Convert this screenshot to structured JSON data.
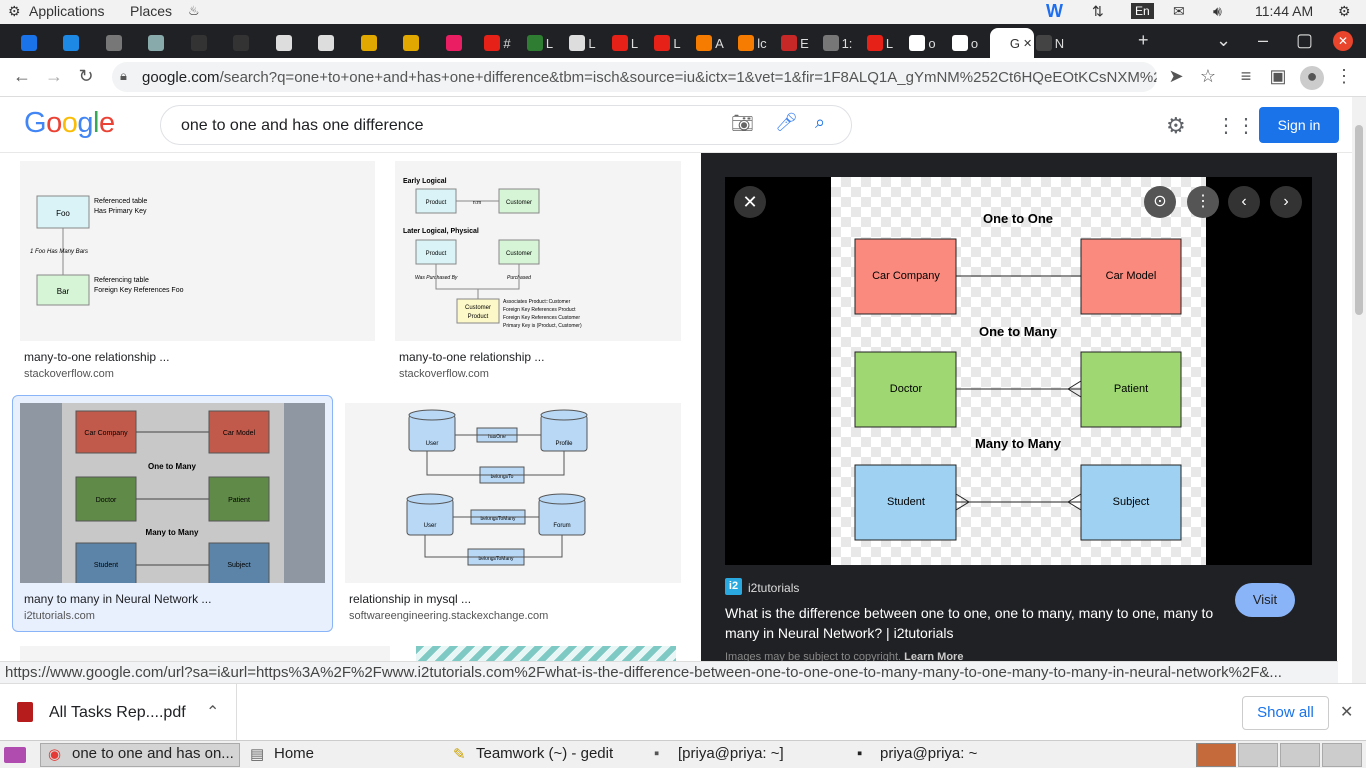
{
  "system": {
    "applications": "Applications",
    "places": "Places",
    "lang": "En",
    "time": "11:44 AM"
  },
  "tabs": [
    {
      "label": "",
      "color": "#1a73e8",
      "icon": "k-icon"
    },
    {
      "label": "",
      "color": "#1e88e5",
      "icon": "s-icon"
    },
    {
      "label": "",
      "color": "#777",
      "icon": "globe-icon"
    },
    {
      "label": "",
      "color": "#8aa",
      "icon": "shield-icon"
    },
    {
      "label": "",
      "color": "#333",
      "icon": "owl-icon"
    },
    {
      "label": "",
      "color": "#333",
      "icon": "github-icon"
    },
    {
      "label": "",
      "color": "#ddd",
      "icon": "dev-icon"
    },
    {
      "label": "",
      "color": "#ddd",
      "icon": "dev-icon"
    },
    {
      "label": "",
      "color": "#e0a800",
      "icon": "d-icon"
    },
    {
      "label": "",
      "color": "#e0a800",
      "icon": "d-icon"
    },
    {
      "label": "",
      "color": "#e91e63",
      "icon": "robot-icon"
    },
    {
      "label": "#",
      "color": "#e62117",
      "icon": "youtube-icon"
    },
    {
      "label": "L",
      "color": "#2e7d32",
      "icon": "ns-icon"
    },
    {
      "label": "L",
      "color": "#ddd",
      "icon": "dev-icon"
    },
    {
      "label": "L",
      "color": "#e62117",
      "icon": "youtube-icon"
    },
    {
      "label": "L",
      "color": "#e62117",
      "icon": "youtube-icon"
    },
    {
      "label": "A",
      "color": "#f57c00",
      "icon": "xampp-icon"
    },
    {
      "label": "lc",
      "color": "#f57c00",
      "icon": "cone-icon"
    },
    {
      "label": "E",
      "color": "#c62828",
      "icon": "laravel-icon"
    },
    {
      "label": "1:",
      "color": "#777",
      "icon": "circle-icon"
    },
    {
      "label": "L",
      "color": "#e62117",
      "icon": "youtube-icon"
    },
    {
      "label": "o",
      "color": "#fff",
      "icon": "google-icon"
    },
    {
      "label": "o",
      "color": "#fff",
      "icon": "google-icon"
    },
    {
      "label": "G",
      "color": "#fff",
      "icon": "google-icon"
    },
    {
      "label": "N",
      "color": "#444",
      "icon": "circle-icon"
    }
  ],
  "address": {
    "url_domain": "google.com",
    "url_rest": "/search?q=one+to+one+and+has+one+difference&tbm=isch&source=iu&ictx=1&vet=1&fir=1F8ALQ1A_gYmNM%252Ct6HQeEOtKCsNXM%252C_..."
  },
  "google": {
    "logo": "Google",
    "query": "one to one and has one difference",
    "signin": "Sign in"
  },
  "results": [
    {
      "title": "many-to-one relationship ...",
      "source": "stackoverflow.com"
    },
    {
      "title": "many-to-one relationship ...",
      "source": "stackoverflow.com"
    },
    {
      "title": "many to many in Neural Network ...",
      "source": "i2tutorials.com"
    },
    {
      "title": "relationship in mysql ...",
      "source": "softwareengineering.stackexchange.com"
    }
  ],
  "thumb1": {
    "foo": "Foo",
    "bar": "Bar",
    "ref1": "Referenced table",
    "ref2": "Has Primary Key",
    "mid": "1 Foo Has Many Bars",
    "fk1": "Referencing table",
    "fk2": "Foreign Key References Foo"
  },
  "thumb2": {
    "early": "Early Logical",
    "later": "Later Logical, Physical",
    "product": "Product",
    "customer": "Customer",
    "nm": "n:m",
    "wp": "Was Purchased By",
    "pu": "Purchased",
    "cp1": "Customer",
    "cp2": "Product",
    "a1": "Associates Product::Customer",
    "a2": "Foreign Key References Product",
    "a3": "Foreign Key References Customer",
    "a4": "Primary Key is (Product, Customer)"
  },
  "thumb3": {
    "cc": "Car Company",
    "cm": "Car Model",
    "otm": "One to Many",
    "doc": "Doctor",
    "pat": "Patient",
    "mtm": "Many to Many",
    "stu": "Student",
    "sub": "Subject"
  },
  "thumb4": {
    "user": "User",
    "hasone": "hasOne",
    "profile": "Profile",
    "belongs": "belongsTo",
    "user2": "User",
    "btm": "belongsToMany",
    "forum": "Forum",
    "btm2": "belongsToMany"
  },
  "preview": {
    "oto": "One to One",
    "car_company": "Car Company",
    "car_model": "Car Model",
    "otm": "One to Many",
    "doctor": "Doctor",
    "patient": "Patient",
    "mtm": "Many to Many",
    "student": "Student",
    "subject": "Subject",
    "site": "i2tutorials",
    "site_logo": "i2",
    "title": "What is the difference between one to one, one to many, many to one, many to many in Neural Network? | i2tutorials",
    "visit": "Visit",
    "copyright": "Images may be subject to copyright.",
    "learn_more": "Learn More"
  },
  "status_url": "https://www.google.com/url?sa=i&url=https%3A%2F%2Fwww.i2tutorials.com%2Fwhat-is-the-difference-between-one-to-one-one-to-many-many-to-one-many-to-many-in-neural-network%2F&...",
  "download": {
    "file": "All Tasks Rep....pdf",
    "show_all": "Show all"
  },
  "taskbar": [
    {
      "label": "one to one and has on..."
    },
    {
      "label": "Home"
    },
    {
      "label": "Teamwork (~) - gedit"
    },
    {
      "label": "[priya@priya: ~]"
    },
    {
      "label": "priya@priya: ~"
    }
  ]
}
